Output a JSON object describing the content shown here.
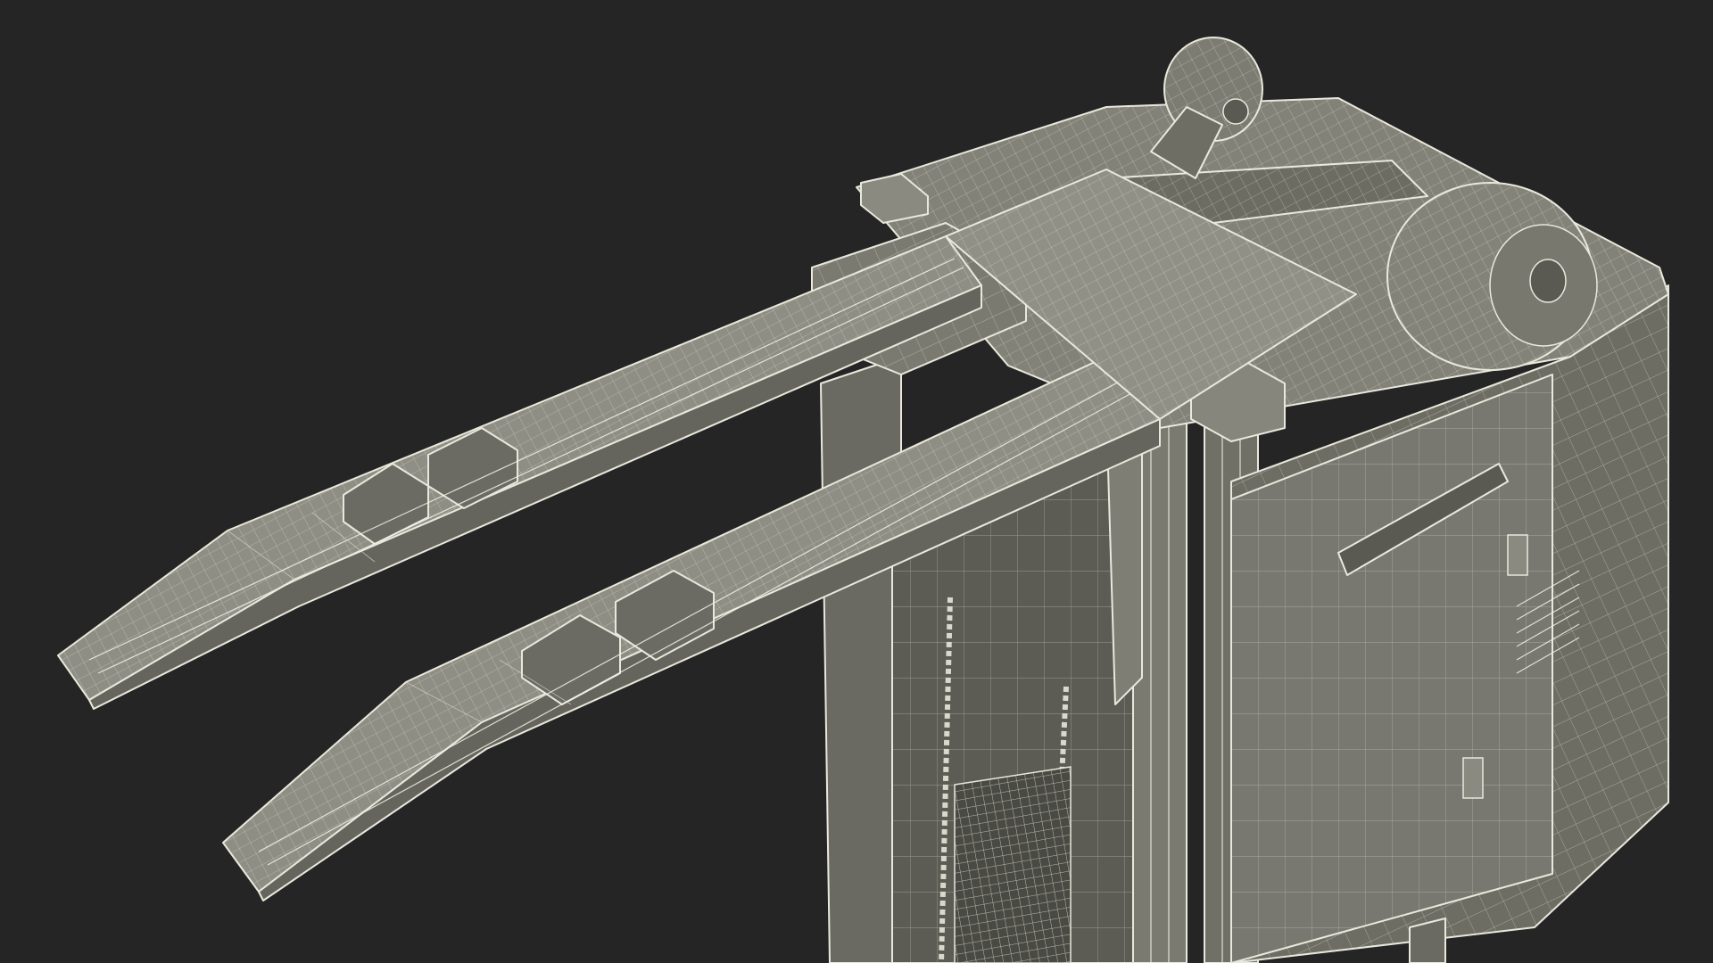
{
  "scene": {
    "subject": "forklift-wireframe-model",
    "colors": {
      "background": "#252525",
      "surface_light": "#8a8a80",
      "surface_mid": "#6f6f66",
      "surface_dark": "#55554e",
      "wire": "#f2f2e8"
    }
  }
}
